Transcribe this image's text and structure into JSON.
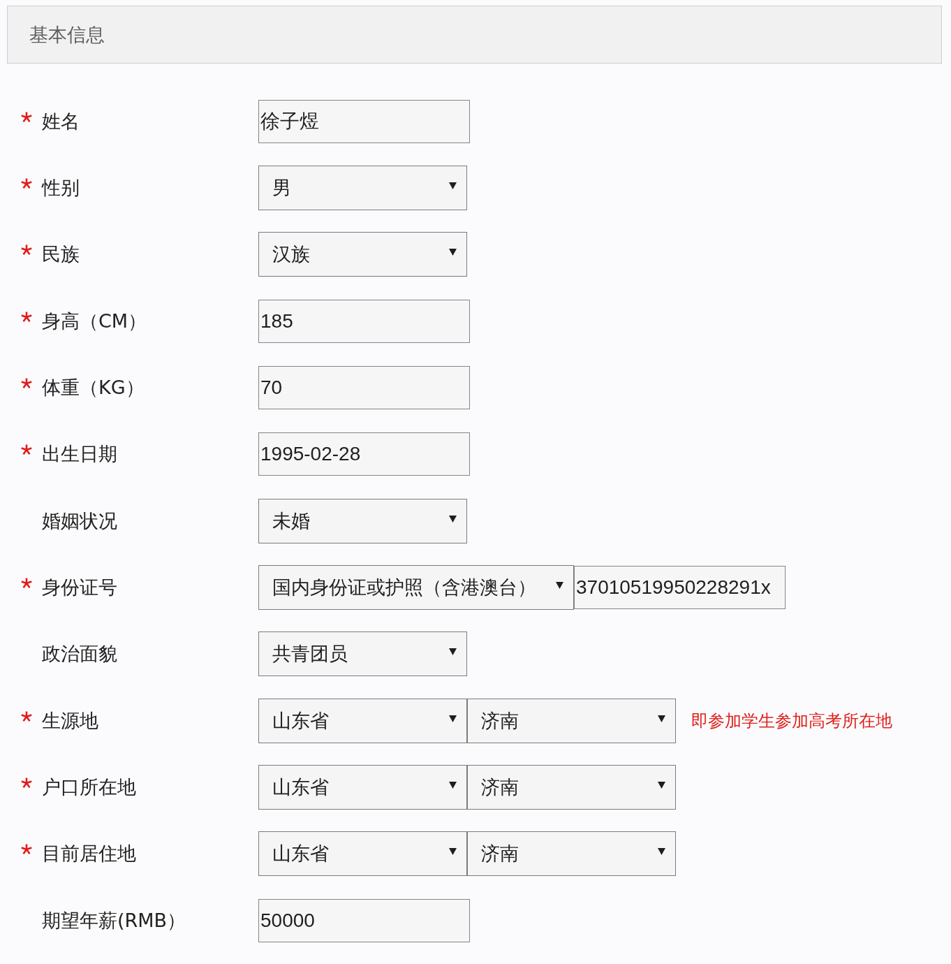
{
  "section": {
    "title": "基本信息"
  },
  "fields": [
    {
      "label": "姓名",
      "required": true,
      "controls": [
        {
          "kind": "text",
          "value": "徐子煜"
        }
      ]
    },
    {
      "label": "性别",
      "required": true,
      "controls": [
        {
          "kind": "select",
          "value": "男"
        }
      ]
    },
    {
      "label": "民族",
      "required": true,
      "controls": [
        {
          "kind": "select",
          "value": "汉族"
        }
      ]
    },
    {
      "label": "身高（CM）",
      "required": true,
      "controls": [
        {
          "kind": "text",
          "value": "185"
        }
      ]
    },
    {
      "label": "体重（KG）",
      "required": true,
      "controls": [
        {
          "kind": "text",
          "value": "70"
        }
      ]
    },
    {
      "label": "出生日期",
      "required": true,
      "controls": [
        {
          "kind": "text",
          "value": "1995-02-28"
        }
      ]
    },
    {
      "label": "婚姻状况",
      "required": false,
      "controls": [
        {
          "kind": "select",
          "value": "未婚"
        }
      ]
    },
    {
      "label": "身份证号",
      "required": true,
      "controls": [
        {
          "kind": "select",
          "value": "国内身份证或护照（含港澳台）"
        },
        {
          "kind": "text",
          "value": "37010519950228291x"
        }
      ]
    },
    {
      "label": "政治面貌",
      "required": false,
      "controls": [
        {
          "kind": "select",
          "value": "共青团员"
        }
      ]
    },
    {
      "label": "生源地",
      "required": true,
      "controls": [
        {
          "kind": "select",
          "value": "山东省"
        },
        {
          "kind": "select",
          "value": "济南"
        }
      ],
      "hint": "即参加学生参加高考所在地"
    },
    {
      "label": "户口所在地",
      "required": true,
      "controls": [
        {
          "kind": "select",
          "value": "山东省"
        },
        {
          "kind": "select",
          "value": "济南"
        }
      ]
    },
    {
      "label": "目前居住地",
      "required": true,
      "controls": [
        {
          "kind": "select",
          "value": "山东省"
        },
        {
          "kind": "select",
          "value": "济南"
        }
      ]
    },
    {
      "label": "期望年薪(RMB）",
      "required": false,
      "controls": [
        {
          "kind": "text",
          "value": "50000"
        }
      ]
    }
  ]
}
